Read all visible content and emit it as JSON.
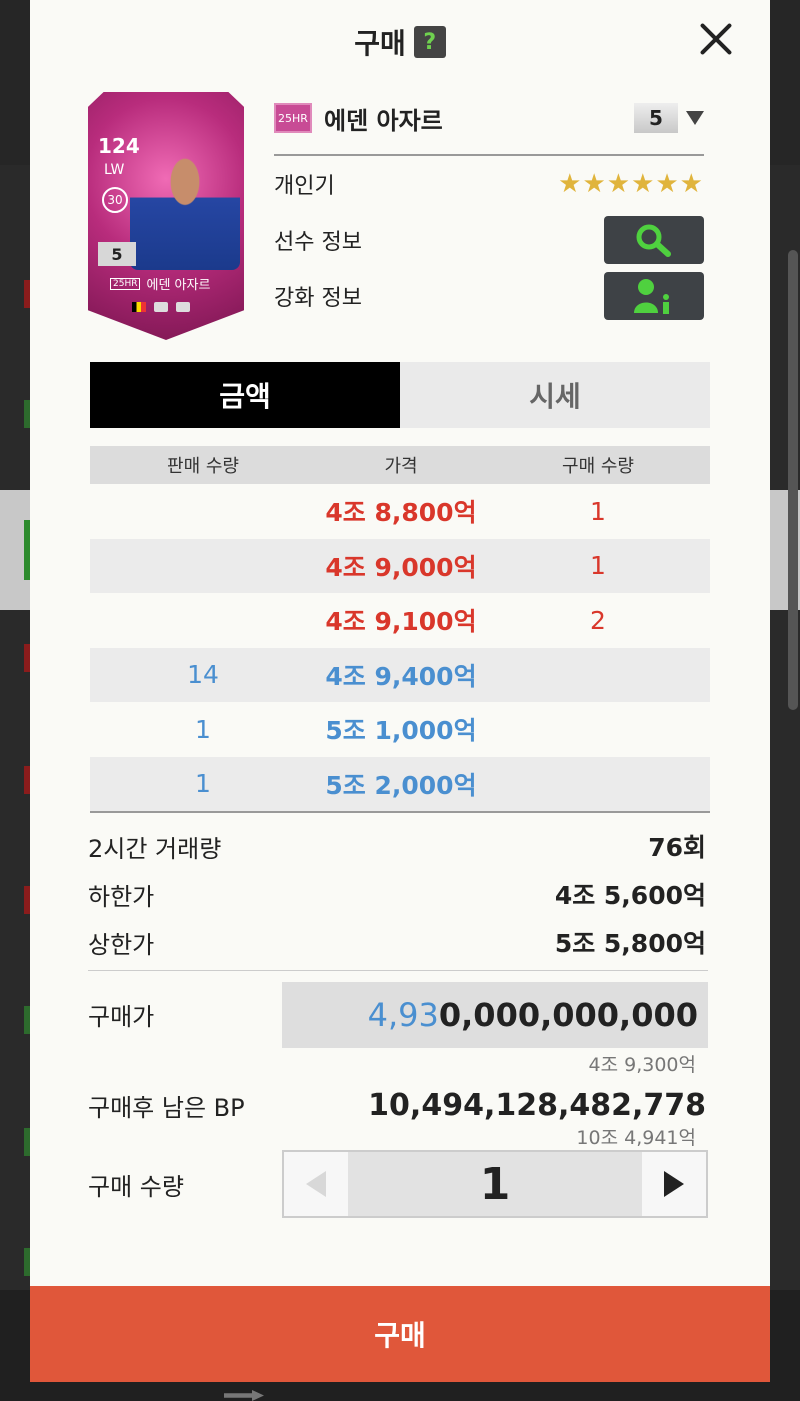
{
  "header": {
    "title": "구매",
    "help_label": "?"
  },
  "card": {
    "rating": "124",
    "position": "LW",
    "circle_value": "30",
    "level": "5",
    "season": "25HR",
    "name": "에덴 아자르"
  },
  "player": {
    "season_badge": "25HR",
    "name": "에덴 아자르",
    "level_selected": "5",
    "rows": [
      {
        "label": "개인기"
      },
      {
        "label": "선수 정보"
      },
      {
        "label": "강화 정보"
      }
    ],
    "stars": "★★★★★★"
  },
  "tabs": [
    {
      "label": "금액"
    },
    {
      "label": "시세"
    }
  ],
  "orders": {
    "headers": [
      "판매 수량",
      "가격",
      "구매 수량"
    ],
    "rows": [
      {
        "sell_qty": "",
        "price": "4조 8,800억",
        "buy_qty": "1"
      },
      {
        "sell_qty": "",
        "price": "4조 9,000억",
        "buy_qty": "1"
      },
      {
        "sell_qty": "",
        "price": "4조 9,100억",
        "buy_qty": "2"
      },
      {
        "sell_qty": "14",
        "price": "4조 9,400억",
        "buy_qty": ""
      },
      {
        "sell_qty": "1",
        "price": "5조 1,000억",
        "buy_qty": ""
      },
      {
        "sell_qty": "1",
        "price": "5조 2,000억",
        "buy_qty": ""
      }
    ]
  },
  "stats": {
    "volume_label": "2시간 거래량",
    "volume_value": "76회",
    "lower_label": "하한가",
    "lower_value": "4조 5,600억",
    "upper_label": "상한가",
    "upper_value": "5조 5,800억"
  },
  "purchase": {
    "price_label": "구매가",
    "price_highlight": "4,93",
    "price_rest": "0,000,000,000",
    "price_note": "4조 9,300억",
    "remaining_label": "구매후 남은 BP",
    "remaining_value": "10,494,128,482,778",
    "remaining_note": "10조 4,941억",
    "qty_label": "구매 수량",
    "qty_value": "1"
  },
  "footer": {
    "buy_label": "구매"
  },
  "colors": {
    "accent": "#e0573a",
    "sell": "#d9372b",
    "buy": "#4a8fd0",
    "star": "#e0b43c"
  }
}
